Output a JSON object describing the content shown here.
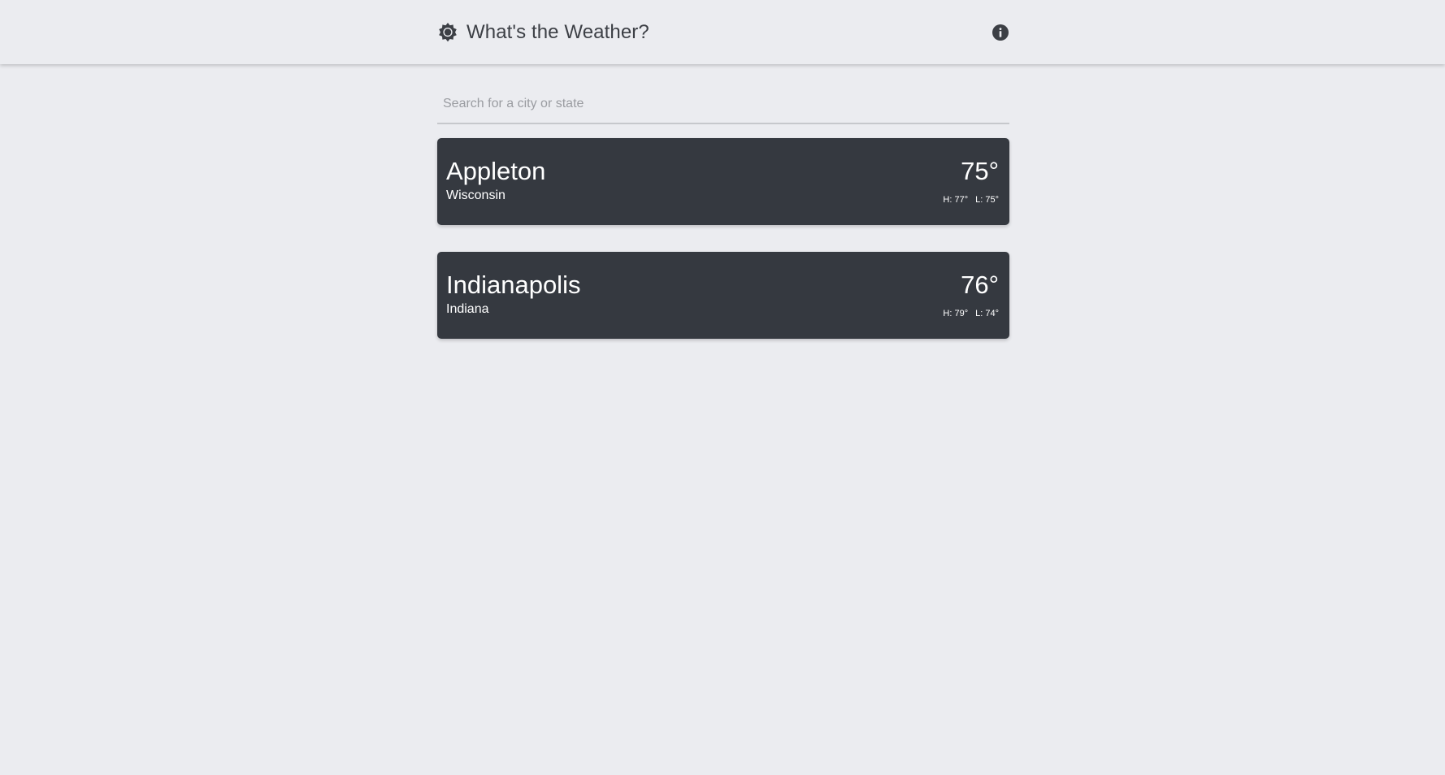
{
  "app": {
    "title": "What's the Weather?",
    "logo_icon": "sun-icon",
    "info_icon": "info-icon"
  },
  "search": {
    "placeholder": "Search for a city or state",
    "value": ""
  },
  "cities": [
    {
      "city": "Appleton",
      "state": "Wisconsin",
      "temp": "75°",
      "high": "H: 77°",
      "low": "L: 75°"
    },
    {
      "city": "Indianapolis",
      "state": "Indiana",
      "temp": "76°",
      "high": "H: 79°",
      "low": "L: 74°"
    }
  ],
  "colors": {
    "background": "#ebecf0",
    "card": "#353940",
    "title_text": "#3c3f45",
    "card_text": "#ffffff"
  }
}
